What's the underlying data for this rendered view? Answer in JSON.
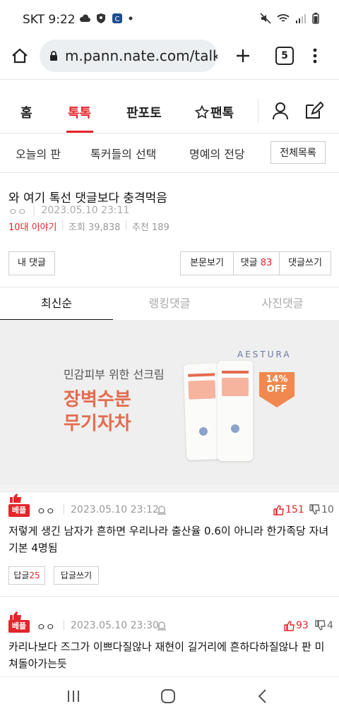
{
  "status_bar": {
    "carrier_time": "SKT 9:22"
  },
  "browser": {
    "url": "m.pann.nate.com/talk",
    "tab_count": "5"
  },
  "gnb": {
    "items": [
      "홈",
      "톡톡",
      "판포토",
      "팬톡"
    ]
  },
  "lnb": {
    "items": [
      "오늘의 판",
      "톡커들의 선택",
      "명예의 전당"
    ],
    "all_button": "전체목록"
  },
  "post": {
    "title": "와 여기 톡선 댓글보다 충격먹음",
    "author": "ㅇㅇ",
    "date": "2023.05.10 23:11",
    "category": "10대 이야기",
    "views_label": "조회",
    "views": "39,838",
    "recommend_label": "추천",
    "recommend": "189"
  },
  "actions": {
    "my_comments": "내 댓글",
    "view_post": "본문보기",
    "comments_label": "댓글",
    "comments_count": "83",
    "write_comment": "댓글쓰기"
  },
  "comment_tabs": [
    "최신순",
    "랭킹댓글",
    "사진댓글"
  ],
  "ad": {
    "subtitle": "민감피부 위한 선크림",
    "headline_1": "장벽수분",
    "headline_2": "무기자차",
    "brand": "AESTURA",
    "discount_pct": "14%",
    "discount_off": "OFF"
  },
  "comments": [
    {
      "badge": "베플",
      "nick": "ㅇㅇ",
      "date": "2023.05.10 23:12",
      "up": "151",
      "down": "10",
      "text": "저렇게 생긴 남자가 흔하면 우리나라 출산율 0.6이 아니라 한가족당 자녀 기본 4명됨",
      "reply_label": "답글",
      "reply_count": "25",
      "write_reply": "답글쓰기"
    },
    {
      "badge": "베플",
      "nick": "ㅇㅇ",
      "date": "2023.05.10 23:30",
      "up": "93",
      "down": "4",
      "text": "카리나보다 즈그가 이쁘다질않나 재현이 길거리에 흔하다하질않나 판 미쳐돌아가는듯"
    }
  ]
}
